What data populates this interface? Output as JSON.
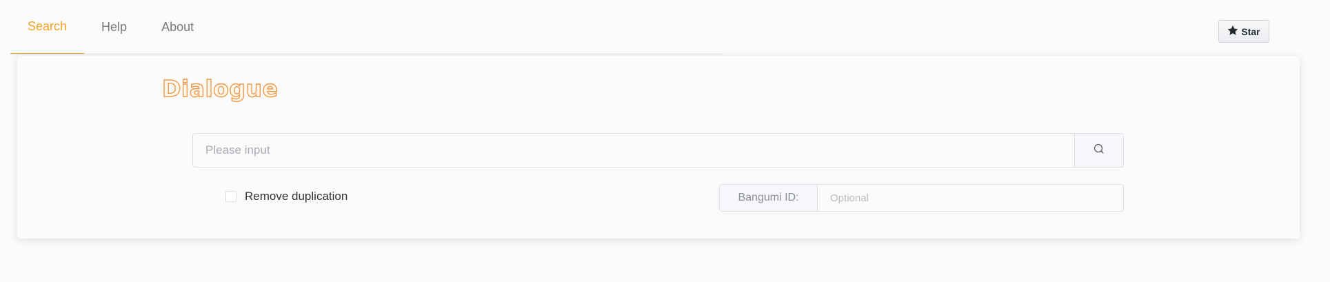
{
  "tabs": [
    {
      "label": "Search",
      "active": true
    },
    {
      "label": "Help",
      "active": false
    },
    {
      "label": "About",
      "active": false
    }
  ],
  "star_button": {
    "label": "Star",
    "icon": "star-icon"
  },
  "card": {
    "title": "Dialogue",
    "search": {
      "value": "",
      "placeholder": "Please input",
      "button_icon": "search-icon"
    },
    "dedupe": {
      "label": "Remove duplication",
      "checked": false
    },
    "bangumi": {
      "prefix": "Bangumi ID:",
      "value": "",
      "placeholder": "Optional"
    }
  },
  "colors": {
    "accent": "#f4a526",
    "title_stroke": "#ef9a4a",
    "border": "#dcdfe6",
    "background": "#fcfbfc"
  }
}
